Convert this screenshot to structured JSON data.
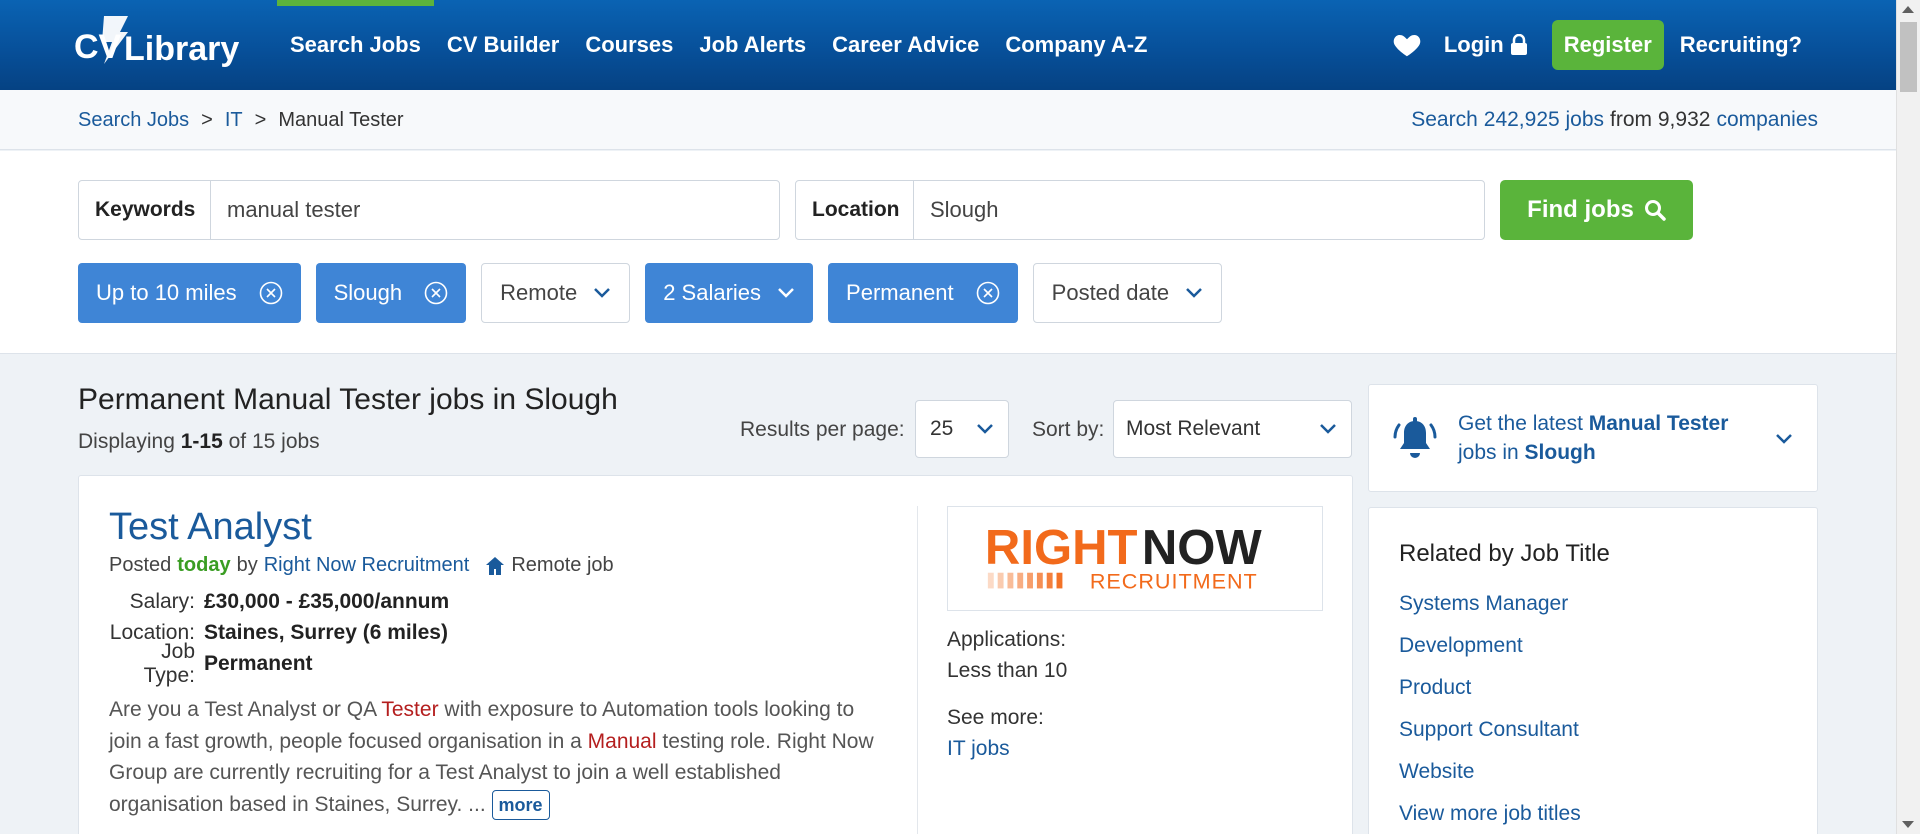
{
  "header": {
    "logo_text": "CV Library",
    "nav": [
      {
        "label": "Search Jobs",
        "active": true
      },
      {
        "label": "CV Builder",
        "active": false
      },
      {
        "label": "Courses",
        "active": false
      },
      {
        "label": "Job Alerts",
        "active": false
      },
      {
        "label": "Career Advice",
        "active": false
      },
      {
        "label": "Company A-Z",
        "active": false
      }
    ],
    "login_label": "Login",
    "register_label": "Register",
    "recruiting_label": "Recruiting?",
    "icons": {
      "favourites": "heart-icon",
      "login": "lock-icon"
    }
  },
  "breadcrumb": {
    "items": [
      "Search Jobs",
      "IT"
    ],
    "current": "Manual Tester",
    "separator": ">"
  },
  "stats": {
    "prefix": "Search",
    "jobs_link": "242,925 jobs",
    "middle": "from 9,932",
    "companies_link": "companies"
  },
  "search": {
    "keywords_label": "Keywords",
    "keywords_value": "manual tester",
    "location_label": "Location",
    "location_value": "Slough",
    "find_label": "Find jobs"
  },
  "filters": [
    {
      "label": "Up to 10 miles",
      "selected": true
    },
    {
      "label": "Slough",
      "selected": true
    },
    {
      "label": "Remote",
      "selected": false
    },
    {
      "label": "2 Salaries",
      "selected": true,
      "dropdown": true
    },
    {
      "label": "Permanent",
      "selected": true
    },
    {
      "label": "Posted date",
      "selected": false
    }
  ],
  "results": {
    "title": "Permanent Manual Tester jobs in Slough",
    "count_prefix": "Displaying",
    "count_range": "1-15",
    "count_suffix": "of 15 jobs",
    "per_page_label": "Results per page:",
    "per_page_value": "25",
    "sort_label": "Sort by:",
    "sort_value": "Most Relevant"
  },
  "job": {
    "title": "Test Analyst",
    "posted_prefix": "Posted",
    "posted_when": "today",
    "posted_by": "by",
    "company": "Right Now Recruitment",
    "remote": "Remote job",
    "salary_label": "Salary:",
    "salary": "£30,000 - £35,000/annum",
    "location_label": "Location:",
    "location": "Staines, Surrey (6 miles)",
    "type_label": "Job Type:",
    "type": "Permanent",
    "desc_1": "Are you a Test Analyst or QA ",
    "desc_hl1": "Tester",
    "desc_2": " with exposure to Automation tools looking to join a fast growth, people focused organisation in a ",
    "desc_hl2": "Manual",
    "desc_3": " testing role. Right Now Group are currently recruiting for a Test Analyst to join a well established organisation based in Staines, Surrey. ... ",
    "more_label": "more",
    "logo_line1_a": "RIGHT",
    "logo_line1_b": "NOW",
    "logo_line2": "RECRUITMENT",
    "applications_label": "Applications:",
    "applications_value": "Less than 10",
    "see_more_label": "See more:",
    "see_more_link": "IT jobs"
  },
  "alert": {
    "prefix": "Get the latest",
    "keyword": "Manual Tester",
    "middle": "jobs in",
    "location": "Slough"
  },
  "related": {
    "heading": "Related by Job Title",
    "items": [
      "Systems Manager",
      "Development",
      "Product",
      "Support Consultant",
      "Website",
      "View more job titles"
    ]
  },
  "colors": {
    "header_blue": "#07509a",
    "green": "#5ab43b",
    "chip_blue": "#3f85d6",
    "link_blue": "#1a5a9b",
    "highlight_red": "#b41e1e",
    "logo_orange": "#f26a1b"
  }
}
